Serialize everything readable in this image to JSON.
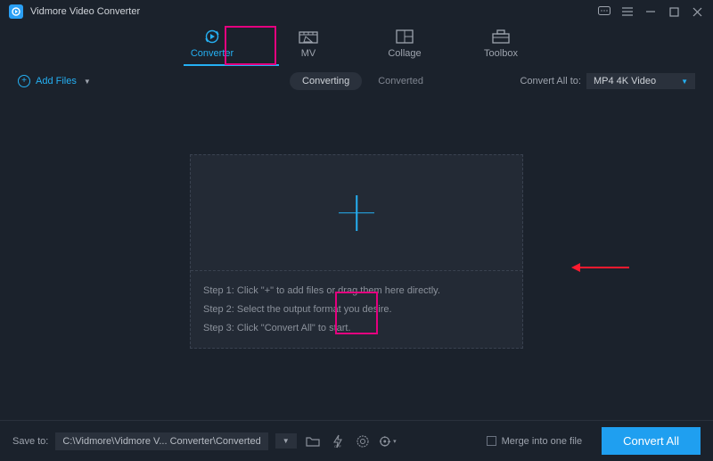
{
  "app": {
    "title": "Vidmore Video Converter"
  },
  "tabs": [
    {
      "label": "Converter",
      "active": true
    },
    {
      "label": "MV"
    },
    {
      "label": "Collage"
    },
    {
      "label": "Toolbox"
    }
  ],
  "toolbar": {
    "add_files": "Add Files",
    "converting": "Converting",
    "converted": "Converted",
    "convert_all_to": "Convert All to:",
    "format_selected": "MP4 4K Video"
  },
  "dropzone": {
    "step1": "Step 1: Click \"+\" to add files or drag them here directly.",
    "step2": "Step 2: Select the output format you desire.",
    "step3": "Step 3: Click \"Convert All\" to start."
  },
  "footer": {
    "save_to": "Save to:",
    "path": "C:\\Vidmore\\Vidmore V... Converter\\Converted",
    "merge": "Merge into one file",
    "convert_all": "Convert All"
  }
}
